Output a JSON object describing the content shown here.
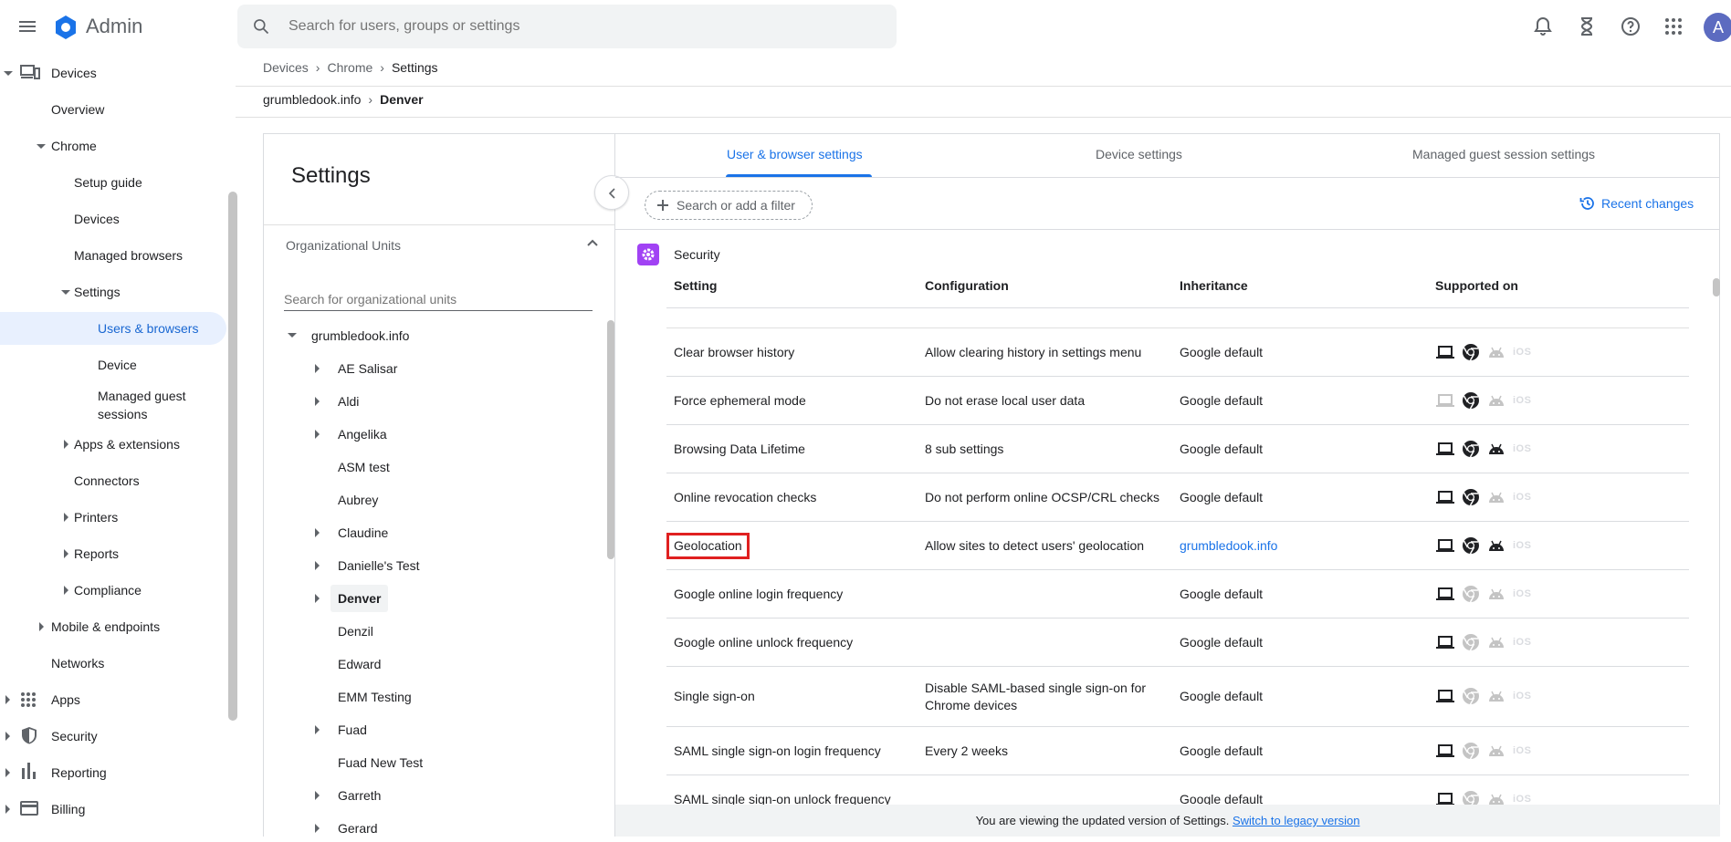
{
  "header": {
    "app_title": "Admin",
    "search_placeholder": "Search for users, groups or settings",
    "avatar_letter": "A"
  },
  "leftnav": {
    "devices": "Devices",
    "overview": "Overview",
    "chrome": "Chrome",
    "setup_guide": "Setup guide",
    "chrome_devices": "Devices",
    "managed_browsers": "Managed browsers",
    "settings": "Settings",
    "users_browsers": "Users & browsers",
    "device": "Device",
    "managed_guest_1": "Managed guest",
    "managed_guest_2": "sessions",
    "apps_extensions": "Apps & extensions",
    "connectors": "Connectors",
    "printers": "Printers",
    "reports": "Reports",
    "compliance": "Compliance",
    "mobile_endpoints": "Mobile & endpoints",
    "networks": "Networks",
    "apps": "Apps",
    "security": "Security",
    "reporting": "Reporting",
    "billing": "Billing"
  },
  "breadcrumb": {
    "level1": "Devices",
    "level2": "Chrome",
    "level3": "Settings",
    "org_root": "grumbledook.info",
    "org_current": "Denver"
  },
  "settings_panel": {
    "title": "Settings",
    "ou_header": "Organizational Units",
    "ou_search_placeholder": "Search for organizational units",
    "root": "grumbledook.info",
    "units": [
      {
        "name": "AE Salisar",
        "expandable": true
      },
      {
        "name": "Aldi",
        "expandable": true
      },
      {
        "name": "Angelika",
        "expandable": true
      },
      {
        "name": "ASM test",
        "expandable": false
      },
      {
        "name": "Aubrey",
        "expandable": false
      },
      {
        "name": "Claudine",
        "expandable": true
      },
      {
        "name": "Danielle's Test",
        "expandable": true
      },
      {
        "name": "Denver",
        "expandable": true,
        "selected": true
      },
      {
        "name": "Denzil",
        "expandable": false
      },
      {
        "name": "Edward",
        "expandable": false
      },
      {
        "name": "EMM Testing",
        "expandable": false
      },
      {
        "name": "Fuad",
        "expandable": true
      },
      {
        "name": "Fuad New Test",
        "expandable": false
      },
      {
        "name": "Garreth",
        "expandable": true
      },
      {
        "name": "Gerard",
        "expandable": true
      }
    ]
  },
  "main": {
    "tabs": [
      "User & browser settings",
      "Device settings",
      "Managed guest session settings"
    ],
    "filter_placeholder": "Search or add a filter",
    "recent_changes": "Recent changes",
    "section_title": "Security",
    "columns": [
      "Setting",
      "Configuration",
      "Inheritance",
      "Supported on"
    ],
    "rows": [
      {
        "setting": "Clear browser history",
        "config": "Allow clearing history in settings menu",
        "config2": "",
        "inheritance": "Google default",
        "support": [
          1,
          1,
          0
        ]
      },
      {
        "setting": "Force ephemeral mode",
        "config": "Do not erase local user data",
        "config2": "",
        "inheritance": "Google default",
        "support": [
          0,
          1,
          0
        ]
      },
      {
        "setting": "Browsing Data Lifetime",
        "config": "8 sub settings",
        "config2": "",
        "inheritance": "Google default",
        "support": [
          1,
          1,
          1
        ]
      },
      {
        "setting": "Online revocation checks",
        "config": "Do not perform online OCSP/CRL checks",
        "config2": "",
        "inheritance": "Google default",
        "support": [
          1,
          1,
          0
        ]
      },
      {
        "setting": "Geolocation",
        "config": "Allow sites to detect users' geolocation",
        "config2": "",
        "inheritance": "grumbledook.info",
        "support": [
          1,
          1,
          1
        ]
      },
      {
        "setting": "Google online login frequency",
        "config": "",
        "config2": "",
        "inheritance": "Google default",
        "support": [
          1,
          0,
          0
        ]
      },
      {
        "setting": "Google online unlock frequency",
        "config": "",
        "config2": "",
        "inheritance": "Google default",
        "support": [
          1,
          0,
          0
        ]
      },
      {
        "setting": "Single sign-on",
        "config": "Disable SAML-based single sign-on for",
        "config2": "Chrome devices",
        "inheritance": "Google default",
        "support": [
          1,
          0,
          0
        ]
      },
      {
        "setting": "SAML single sign-on login frequency",
        "config": "Every 2 weeks",
        "config2": "",
        "inheritance": "Google default",
        "support": [
          1,
          0,
          0
        ]
      },
      {
        "setting": "SAML single sign-on unlock frequency",
        "config": "",
        "config2": "",
        "inheritance": "Google default",
        "support": [
          1,
          0,
          0
        ]
      }
    ],
    "ios_label": "iOS"
  },
  "footer": {
    "text": "You are viewing the updated version of Settings.",
    "link": "Switch to legacy version"
  },
  "colors": {
    "accent": "#1a73e8",
    "highlight": "#e02020",
    "security_icon": "#a142f4"
  }
}
